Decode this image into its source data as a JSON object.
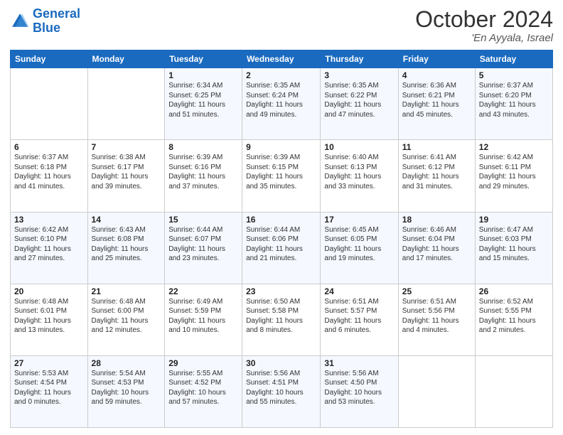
{
  "logo": {
    "text_general": "General",
    "text_blue": "Blue"
  },
  "header": {
    "month": "October 2024",
    "location": "'En Ayyala, Israel"
  },
  "days_of_week": [
    "Sunday",
    "Monday",
    "Tuesday",
    "Wednesday",
    "Thursday",
    "Friday",
    "Saturday"
  ],
  "weeks": [
    [
      {
        "day": "",
        "info": ""
      },
      {
        "day": "",
        "info": ""
      },
      {
        "day": "1",
        "info": "Sunrise: 6:34 AM\nSunset: 6:25 PM\nDaylight: 11 hours\nand 51 minutes."
      },
      {
        "day": "2",
        "info": "Sunrise: 6:35 AM\nSunset: 6:24 PM\nDaylight: 11 hours\nand 49 minutes."
      },
      {
        "day": "3",
        "info": "Sunrise: 6:35 AM\nSunset: 6:22 PM\nDaylight: 11 hours\nand 47 minutes."
      },
      {
        "day": "4",
        "info": "Sunrise: 6:36 AM\nSunset: 6:21 PM\nDaylight: 11 hours\nand 45 minutes."
      },
      {
        "day": "5",
        "info": "Sunrise: 6:37 AM\nSunset: 6:20 PM\nDaylight: 11 hours\nand 43 minutes."
      }
    ],
    [
      {
        "day": "6",
        "info": "Sunrise: 6:37 AM\nSunset: 6:18 PM\nDaylight: 11 hours\nand 41 minutes."
      },
      {
        "day": "7",
        "info": "Sunrise: 6:38 AM\nSunset: 6:17 PM\nDaylight: 11 hours\nand 39 minutes."
      },
      {
        "day": "8",
        "info": "Sunrise: 6:39 AM\nSunset: 6:16 PM\nDaylight: 11 hours\nand 37 minutes."
      },
      {
        "day": "9",
        "info": "Sunrise: 6:39 AM\nSunset: 6:15 PM\nDaylight: 11 hours\nand 35 minutes."
      },
      {
        "day": "10",
        "info": "Sunrise: 6:40 AM\nSunset: 6:13 PM\nDaylight: 11 hours\nand 33 minutes."
      },
      {
        "day": "11",
        "info": "Sunrise: 6:41 AM\nSunset: 6:12 PM\nDaylight: 11 hours\nand 31 minutes."
      },
      {
        "day": "12",
        "info": "Sunrise: 6:42 AM\nSunset: 6:11 PM\nDaylight: 11 hours\nand 29 minutes."
      }
    ],
    [
      {
        "day": "13",
        "info": "Sunrise: 6:42 AM\nSunset: 6:10 PM\nDaylight: 11 hours\nand 27 minutes."
      },
      {
        "day": "14",
        "info": "Sunrise: 6:43 AM\nSunset: 6:08 PM\nDaylight: 11 hours\nand 25 minutes."
      },
      {
        "day": "15",
        "info": "Sunrise: 6:44 AM\nSunset: 6:07 PM\nDaylight: 11 hours\nand 23 minutes."
      },
      {
        "day": "16",
        "info": "Sunrise: 6:44 AM\nSunset: 6:06 PM\nDaylight: 11 hours\nand 21 minutes."
      },
      {
        "day": "17",
        "info": "Sunrise: 6:45 AM\nSunset: 6:05 PM\nDaylight: 11 hours\nand 19 minutes."
      },
      {
        "day": "18",
        "info": "Sunrise: 6:46 AM\nSunset: 6:04 PM\nDaylight: 11 hours\nand 17 minutes."
      },
      {
        "day": "19",
        "info": "Sunrise: 6:47 AM\nSunset: 6:03 PM\nDaylight: 11 hours\nand 15 minutes."
      }
    ],
    [
      {
        "day": "20",
        "info": "Sunrise: 6:48 AM\nSunset: 6:01 PM\nDaylight: 11 hours\nand 13 minutes."
      },
      {
        "day": "21",
        "info": "Sunrise: 6:48 AM\nSunset: 6:00 PM\nDaylight: 11 hours\nand 12 minutes."
      },
      {
        "day": "22",
        "info": "Sunrise: 6:49 AM\nSunset: 5:59 PM\nDaylight: 11 hours\nand 10 minutes."
      },
      {
        "day": "23",
        "info": "Sunrise: 6:50 AM\nSunset: 5:58 PM\nDaylight: 11 hours\nand 8 minutes."
      },
      {
        "day": "24",
        "info": "Sunrise: 6:51 AM\nSunset: 5:57 PM\nDaylight: 11 hours\nand 6 minutes."
      },
      {
        "day": "25",
        "info": "Sunrise: 6:51 AM\nSunset: 5:56 PM\nDaylight: 11 hours\nand 4 minutes."
      },
      {
        "day": "26",
        "info": "Sunrise: 6:52 AM\nSunset: 5:55 PM\nDaylight: 11 hours\nand 2 minutes."
      }
    ],
    [
      {
        "day": "27",
        "info": "Sunrise: 5:53 AM\nSunset: 4:54 PM\nDaylight: 11 hours\nand 0 minutes."
      },
      {
        "day": "28",
        "info": "Sunrise: 5:54 AM\nSunset: 4:53 PM\nDaylight: 10 hours\nand 59 minutes."
      },
      {
        "day": "29",
        "info": "Sunrise: 5:55 AM\nSunset: 4:52 PM\nDaylight: 10 hours\nand 57 minutes."
      },
      {
        "day": "30",
        "info": "Sunrise: 5:56 AM\nSunset: 4:51 PM\nDaylight: 10 hours\nand 55 minutes."
      },
      {
        "day": "31",
        "info": "Sunrise: 5:56 AM\nSunset: 4:50 PM\nDaylight: 10 hours\nand 53 minutes."
      },
      {
        "day": "",
        "info": ""
      },
      {
        "day": "",
        "info": ""
      }
    ]
  ]
}
